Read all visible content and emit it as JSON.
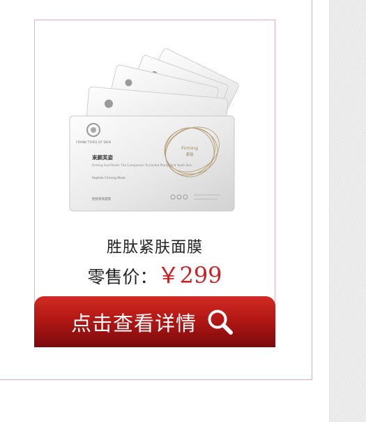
{
  "product": {
    "name": "胜肽紧肤面膜",
    "price_label": "零售价：",
    "price_value": "￥299",
    "packaging_text": {
      "brand_en": "FRANK TYPES OF SKIN",
      "name_cn": "束颜芙姿",
      "tagline": "Firming And Plastic The Complexion To Exhibit Plump And Youth Skin",
      "type_en": "Peptide Firming Mask",
      "type_cn": "胜肽紧肤面膜",
      "emblem_en": "Firming",
      "emblem_cn": "紧致"
    }
  },
  "actions": {
    "detail_label": "点击查看详情"
  },
  "colors": {
    "price": "#cc1f24",
    "button_top": "#d12b22",
    "button_bottom": "#7a0a0c",
    "frame_pink": "#e7b3c0"
  },
  "icons": {
    "detail_icon": "search-icon"
  }
}
